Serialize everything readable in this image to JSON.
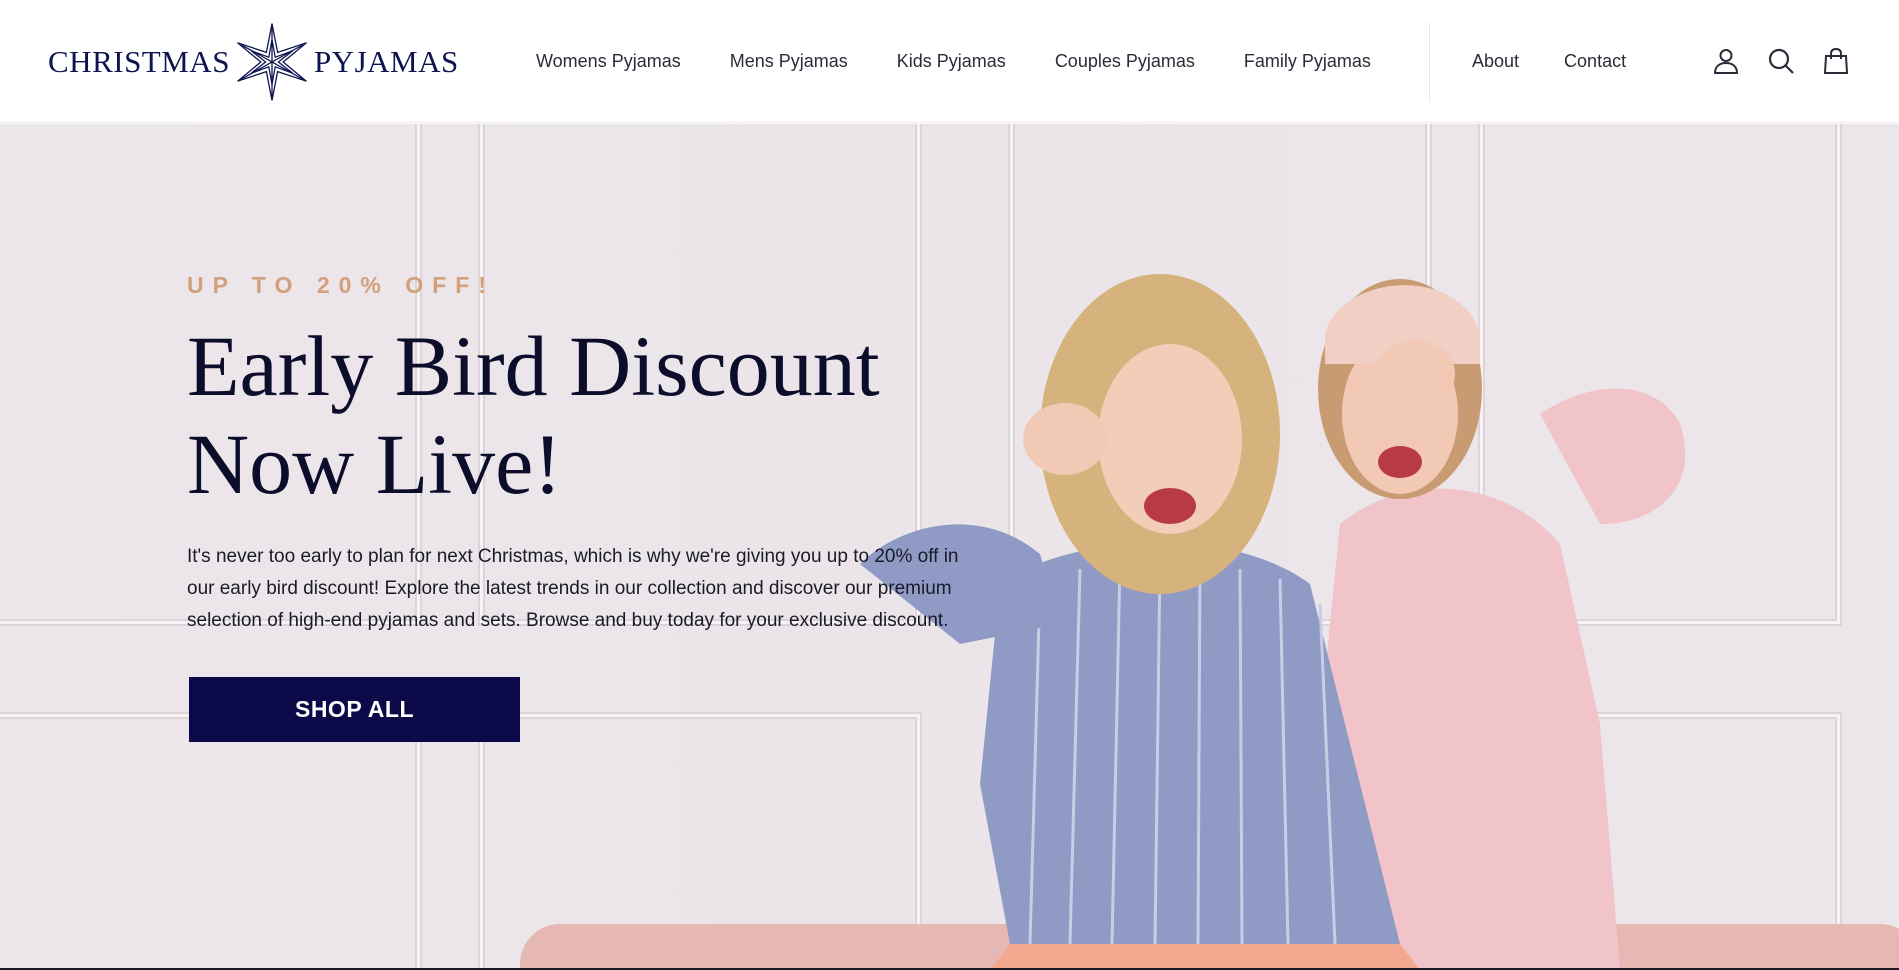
{
  "brand": {
    "name_left": "CHRISTMAS",
    "name_right": "PYJAMAS",
    "logo_icon": "star-icon",
    "color": "#0d1450"
  },
  "nav": {
    "main": [
      {
        "label": "Womens Pyjamas"
      },
      {
        "label": "Mens Pyjamas"
      },
      {
        "label": "Kids Pyjamas"
      },
      {
        "label": "Couples Pyjamas"
      },
      {
        "label": "Family Pyjamas"
      }
    ],
    "secondary": [
      {
        "label": "About"
      },
      {
        "label": "Contact"
      }
    ],
    "icons": [
      "account-icon",
      "search-icon",
      "cart-icon"
    ]
  },
  "hero": {
    "eyebrow": "UP TO 20% OFF!",
    "headline_line1": "Early Bird Discount",
    "headline_line2": "Now Live!",
    "body": "It's never too early to plan for next Christmas, which is why we're giving you up to 20% off in our early bird discount! Explore the latest trends in our collection and discover our premium selection of high-end pyjamas and sets. Browse and buy today for your exclusive discount.",
    "cta_label": "SHOP ALL",
    "colors": {
      "eyebrow": "#d2a07b",
      "headline": "#0b0d2a",
      "cta_bg": "#0b0948",
      "background": "#ece7ea"
    }
  }
}
